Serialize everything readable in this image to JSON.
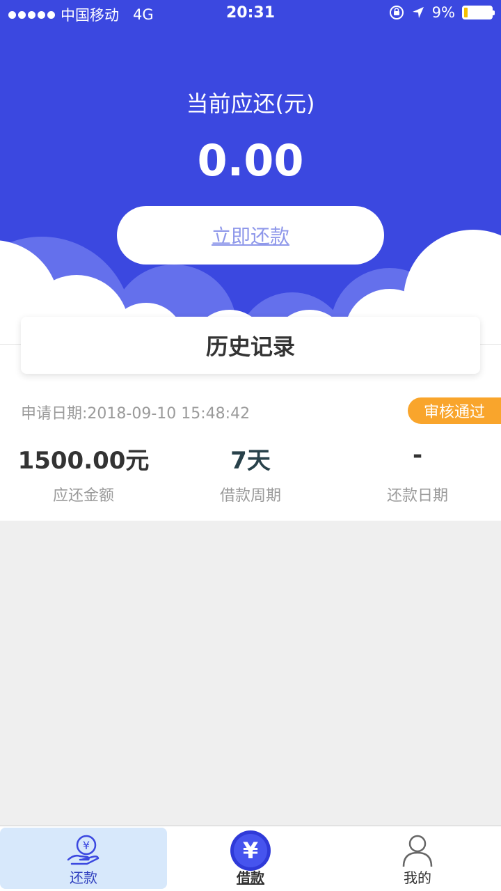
{
  "status_bar": {
    "carrier": "中国移动",
    "network": "4G",
    "time": "20:31",
    "battery": "9%"
  },
  "header": {
    "title": "当前应还(元)",
    "amount": "0.00",
    "pay_button": "立即还款"
  },
  "history": {
    "title": "历史记录",
    "record": {
      "date": "申请日期:2018-09-10 15:48:42",
      "status": "审核通过",
      "amount_value": "1500.00元",
      "amount_label": "应还金额",
      "period_value": "7天",
      "period_label": "借款周期",
      "repay_date_value": "-",
      "repay_date_label": "还款日期"
    }
  },
  "tabs": [
    {
      "label": "还款",
      "icon": "repay-hand-yen-icon",
      "active": true
    },
    {
      "label": "借款",
      "icon": "yen-circle-icon",
      "active": false
    },
    {
      "label": "我的",
      "icon": "person-icon",
      "active": false
    }
  ],
  "colors": {
    "primary": "#3b48e0",
    "badge": "#f9a52c",
    "active_tab_bg": "#d7e8fb"
  }
}
